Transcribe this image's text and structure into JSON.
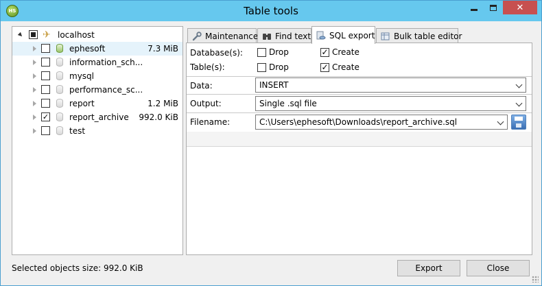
{
  "window": {
    "title": "Table tools",
    "app_icon_text": "HS",
    "close_glyph": "✕"
  },
  "tree": {
    "root": {
      "label": "localhost",
      "check_state": "partial",
      "expanded": true
    },
    "items": [
      {
        "label": "ephesoft",
        "size": "7.3 MiB",
        "checked": false,
        "selected": true
      },
      {
        "label": "information_sch...",
        "size": "",
        "checked": false,
        "selected": false
      },
      {
        "label": "mysql",
        "size": "",
        "checked": false,
        "selected": false
      },
      {
        "label": "performance_sc...",
        "size": "",
        "checked": false,
        "selected": false
      },
      {
        "label": "report",
        "size": "1.2 MiB",
        "checked": false,
        "selected": false
      },
      {
        "label": "report_archive",
        "size": "992.0 KiB",
        "checked": true,
        "selected": false
      },
      {
        "label": "test",
        "size": "",
        "checked": false,
        "selected": false
      }
    ]
  },
  "tabs": [
    {
      "label": "Maintenance",
      "icon": "wrench-icon",
      "active": false
    },
    {
      "label": "Find text",
      "icon": "binoculars-icon",
      "active": false
    },
    {
      "label": "SQL export",
      "icon": "database-export-icon",
      "active": true
    },
    {
      "label": "Bulk table editor",
      "icon": "table-edit-icon",
      "active": false
    }
  ],
  "sql_export": {
    "databases_label": "Database(s):",
    "tables_label": "Table(s):",
    "drop_label": "Drop",
    "create_label": "Create",
    "db_drop": false,
    "db_create": true,
    "table_drop": false,
    "table_create": true,
    "data_label": "Data:",
    "data_value": "INSERT",
    "output_label": "Output:",
    "output_value": "Single .sql file",
    "filename_label": "Filename:",
    "filename_value": "C:\\Users\\ephesoft\\Downloads\\report_archive.sql"
  },
  "footer": {
    "status": "Selected objects size: 992.0 KiB",
    "export_label": "Export",
    "close_label": "Close"
  },
  "check_glyph": "✓"
}
